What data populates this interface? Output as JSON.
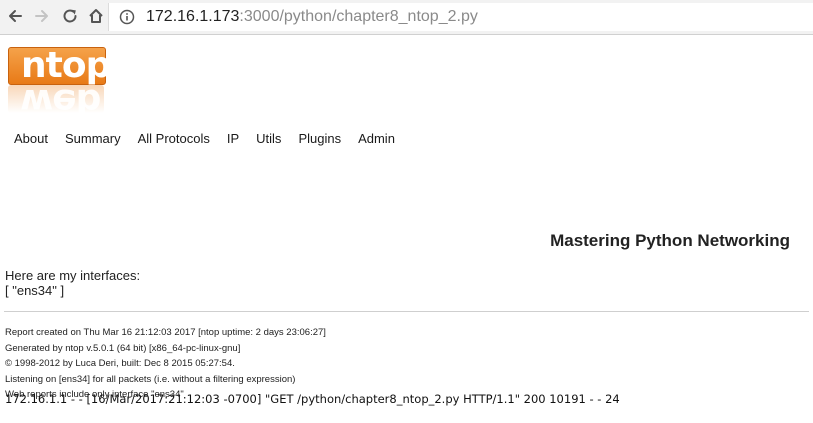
{
  "browser": {
    "url_host": "172.16.1.173",
    "url_rest": ":3000/python/chapter8_ntop_2.py",
    "icons": [
      "back-arrow-icon",
      "forward-arrow-icon",
      "reload-icon",
      "home-icon",
      "info-icon"
    ]
  },
  "logo": {
    "text": "ntop",
    "brand_color": "#e87a17"
  },
  "menu": {
    "items": [
      "About",
      "Summary",
      "All Protocols",
      "IP",
      "Utils",
      "Plugins",
      "Admin"
    ]
  },
  "main": {
    "heading": "Mastering Python Networking",
    "interfaces_label": "Here are my interfaces:",
    "interfaces_list": "[ \"ens34\" ]"
  },
  "footer": {
    "lines": [
      "Report created on Thu Mar 16 21:12:03 2017 [ntop uptime: 2 days 23:06:27]",
      "Generated by ntop v.5.0.1 (64 bit) [x86_64-pc-linux-gnu]",
      "© 1998-2012 by Luca Deri, built: Dec 8 2015 05:27:54.",
      "Listening on [ens34] for all packets (i.e. without a filtering expression)",
      "Web reports include only interface \"ens34\""
    ]
  },
  "console": {
    "log_line": "172.16.1.1 - - [16/Mar/2017:21:12:03 -0700] \"GET /python/chapter8_ntop_2.py HTTP/1.1\" 200 10191 - - 24"
  }
}
